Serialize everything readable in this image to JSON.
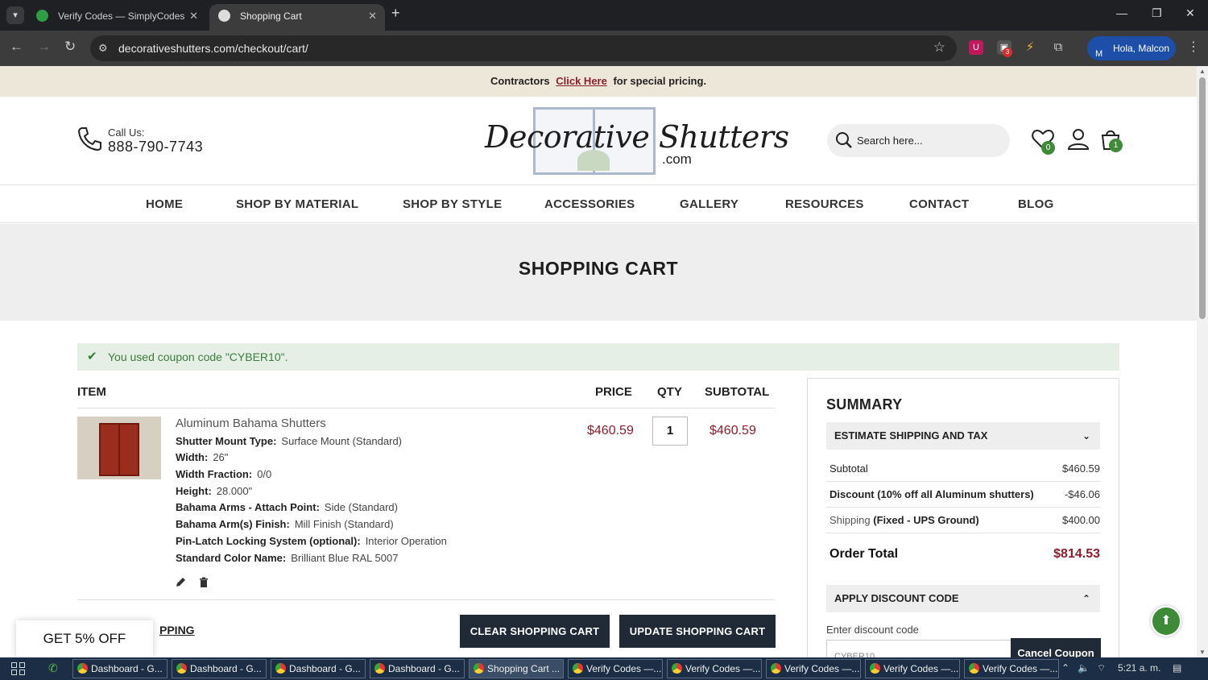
{
  "browser": {
    "tabs": [
      {
        "title": "Verify Codes — SimplyCodes",
        "active": false
      },
      {
        "title": "Shopping Cart",
        "active": true
      }
    ],
    "url": "decorativeshutters.com/checkout/cart/",
    "profile_initial": "M",
    "profile_label": "Hola, Malcon",
    "extension_badge": "3"
  },
  "promo": {
    "lead": "Contractors",
    "link": "Click Here",
    "tail": "for special pricing."
  },
  "header": {
    "call_label": "Call Us:",
    "phone": "888-790-7743",
    "logo_text": "Decorative Shutters",
    "logo_suffix": ".com",
    "search_placeholder": "Search here...",
    "wishlist_count": "0",
    "cart_count": "1"
  },
  "nav": [
    "HOME",
    "SHOP BY MATERIAL",
    "SHOP BY STYLE",
    "ACCESSORIES",
    "GALLERY",
    "RESOURCES",
    "CONTACT",
    "BLOG"
  ],
  "page_title": "SHOPPING CART",
  "notice": "You used coupon code \"CYBER10\".",
  "cart": {
    "headers": {
      "item": "ITEM",
      "price": "PRICE",
      "qty": "QTY",
      "subtotal": "SUBTOTAL"
    },
    "item": {
      "name": "Aluminum Bahama Shutters",
      "price": "$460.59",
      "qty": "1",
      "subtotal": "$460.59",
      "attributes": [
        {
          "label": "Shutter Mount Type:",
          "value": "Surface Mount (Standard)"
        },
        {
          "label": "Width:",
          "value": "26\""
        },
        {
          "label": "Width Fraction:",
          "value": "0/0"
        },
        {
          "label": "Height:",
          "value": "28.000\""
        },
        {
          "label": "Bahama Arms - Attach Point:",
          "value": "Side (Standard)"
        },
        {
          "label": "Bahama Arm(s) Finish:",
          "value": "Mill Finish (Standard)"
        },
        {
          "label": "Pin-Latch Locking System (optional):",
          "value": "Interior Operation"
        },
        {
          "label": "Standard Color Name:",
          "value": "Brilliant Blue RAL 5007"
        }
      ]
    },
    "continue_partial": "PPING",
    "clear_button": "CLEAR SHOPPING CART",
    "update_button": "UPDATE SHOPPING CART"
  },
  "summary": {
    "title": "SUMMARY",
    "shipping_tax_label": "ESTIMATE SHIPPING AND TAX",
    "subtotal_label": "Subtotal",
    "subtotal_value": "$460.59",
    "discount_label": "Discount (10% off all Aluminum shutters)",
    "discount_value": "-$46.06",
    "shipping_label": "Shipping",
    "shipping_method": "(Fixed - UPS Ground)",
    "shipping_value": "$400.00",
    "order_total_label": "Order Total",
    "order_total_value": "$814.53",
    "discount_code_label": "APPLY DISCOUNT CODE",
    "enter_code_label": "Enter discount code",
    "code_value": "CYBER10",
    "cancel_coupon": "Cancel Coupon"
  },
  "popup": "GET 5% OFF",
  "taskbar": {
    "items": [
      "Dashboard - G...",
      "Dashboard - G...",
      "Dashboard - G...",
      "Dashboard - G...",
      "Shopping Cart ...",
      "Verify Codes —...",
      "Verify Codes —...",
      "Verify Codes —...",
      "Verify Codes —...",
      "Verify Codes —..."
    ],
    "time": "5:21 a. m."
  }
}
